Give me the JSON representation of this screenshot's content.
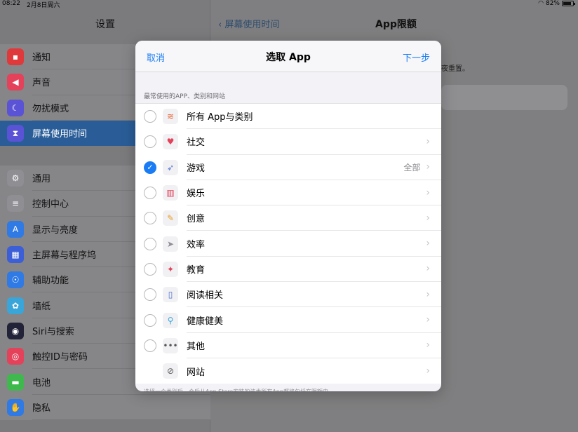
{
  "status_bar": {
    "time": "08:22",
    "date": "2月8日周六",
    "battery": "82%"
  },
  "sidebar": {
    "title": "设置",
    "group1": [
      {
        "label": "通知",
        "icon": "notification-icon",
        "color": "#e0393b",
        "glyph": "▪"
      },
      {
        "label": "声音",
        "icon": "speaker-icon",
        "color": "#e3425a",
        "glyph": "◀"
      },
      {
        "label": "勿扰模式",
        "icon": "moon-icon",
        "color": "#5b53d6",
        "glyph": "☾"
      },
      {
        "label": "屏幕使用时间",
        "icon": "hourglass-icon",
        "color": "#5b53d6",
        "glyph": "⧗",
        "active": true
      }
    ],
    "group2": [
      {
        "label": "通用",
        "icon": "gear-icon",
        "color": "#8e8e93",
        "glyph": "⚙"
      },
      {
        "label": "控制中心",
        "icon": "switches-icon",
        "color": "#8e8e93",
        "glyph": "≡"
      },
      {
        "label": "显示与亮度",
        "icon": "text-size-icon",
        "color": "#2f7ae5",
        "glyph": "A"
      },
      {
        "label": "主屏幕与程序坞",
        "icon": "grid-icon",
        "color": "#3c5fd7",
        "glyph": "▦"
      },
      {
        "label": "辅助功能",
        "icon": "accessibility-icon",
        "color": "#2f7ae5",
        "glyph": "☉"
      },
      {
        "label": "墙纸",
        "icon": "flower-icon",
        "color": "#3aa5d8",
        "glyph": "✿"
      },
      {
        "label": "Siri与搜索",
        "icon": "siri-icon",
        "color": "#222238",
        "glyph": "◉"
      },
      {
        "label": "触控ID与密码",
        "icon": "fingerprint-icon",
        "color": "#e3425a",
        "glyph": "◎"
      },
      {
        "label": "电池",
        "icon": "battery-icon",
        "color": "#3fb94d",
        "glyph": "▬"
      },
      {
        "label": "隐私",
        "icon": "hand-icon",
        "color": "#2f7ae5",
        "glyph": "✋"
      }
    ]
  },
  "detail": {
    "back_label": "屏幕使用时间",
    "title": "App限额",
    "hint": "夜重置。"
  },
  "modal": {
    "cancel": "取消",
    "title": "选取 App",
    "next": "下一步",
    "section_header": "最常使用的APP、类别和网站",
    "rows": [
      {
        "label": "所有 App与类别",
        "icon": "stack-icon",
        "glyph": "≋",
        "icon_color": "#e85d2a",
        "state": "off",
        "chevron": false,
        "value": ""
      },
      {
        "label": "社交",
        "icon": "chat-bubble-icon",
        "glyph": "♥",
        "icon_color": "#e3425a",
        "state": "off",
        "chevron": true,
        "value": ""
      },
      {
        "label": "游戏",
        "icon": "rocket-icon",
        "glyph": "➶",
        "icon_color": "#4a6fd0",
        "state": "on",
        "chevron": true,
        "value": "全部"
      },
      {
        "label": "娱乐",
        "icon": "popcorn-icon",
        "glyph": "▥",
        "icon_color": "#e3425a",
        "state": "off",
        "chevron": true,
        "value": ""
      },
      {
        "label": "创意",
        "icon": "palette-icon",
        "glyph": "✎",
        "icon_color": "#e8a02a",
        "state": "off",
        "chevron": true,
        "value": ""
      },
      {
        "label": "效率",
        "icon": "paper-plane-icon",
        "glyph": "➤",
        "icon_color": "#8e8e93",
        "state": "off",
        "chevron": true,
        "value": ""
      },
      {
        "label": "教育",
        "icon": "education-icon",
        "glyph": "✦",
        "icon_color": "#e3425a",
        "state": "off",
        "chevron": true,
        "value": ""
      },
      {
        "label": "阅读相关",
        "icon": "book-icon",
        "glyph": "▯",
        "icon_color": "#4a6fd0",
        "state": "off",
        "chevron": true,
        "value": ""
      },
      {
        "label": "健康健美",
        "icon": "bicycle-icon",
        "glyph": "⚲",
        "icon_color": "#3aa5d8",
        "state": "off",
        "chevron": true,
        "value": ""
      },
      {
        "label": "其他",
        "icon": "more-icon",
        "glyph": "•••",
        "icon_color": "#555555",
        "state": "off",
        "chevron": true,
        "value": ""
      },
      {
        "label": "网站",
        "icon": "compass-icon",
        "glyph": "⊘",
        "icon_color": "#555555",
        "state": "none",
        "chevron": true,
        "value": ""
      }
    ],
    "footer_note": "选择一个类别后，会后从App Store安装的该类所有App都将包括在限额中。"
  }
}
